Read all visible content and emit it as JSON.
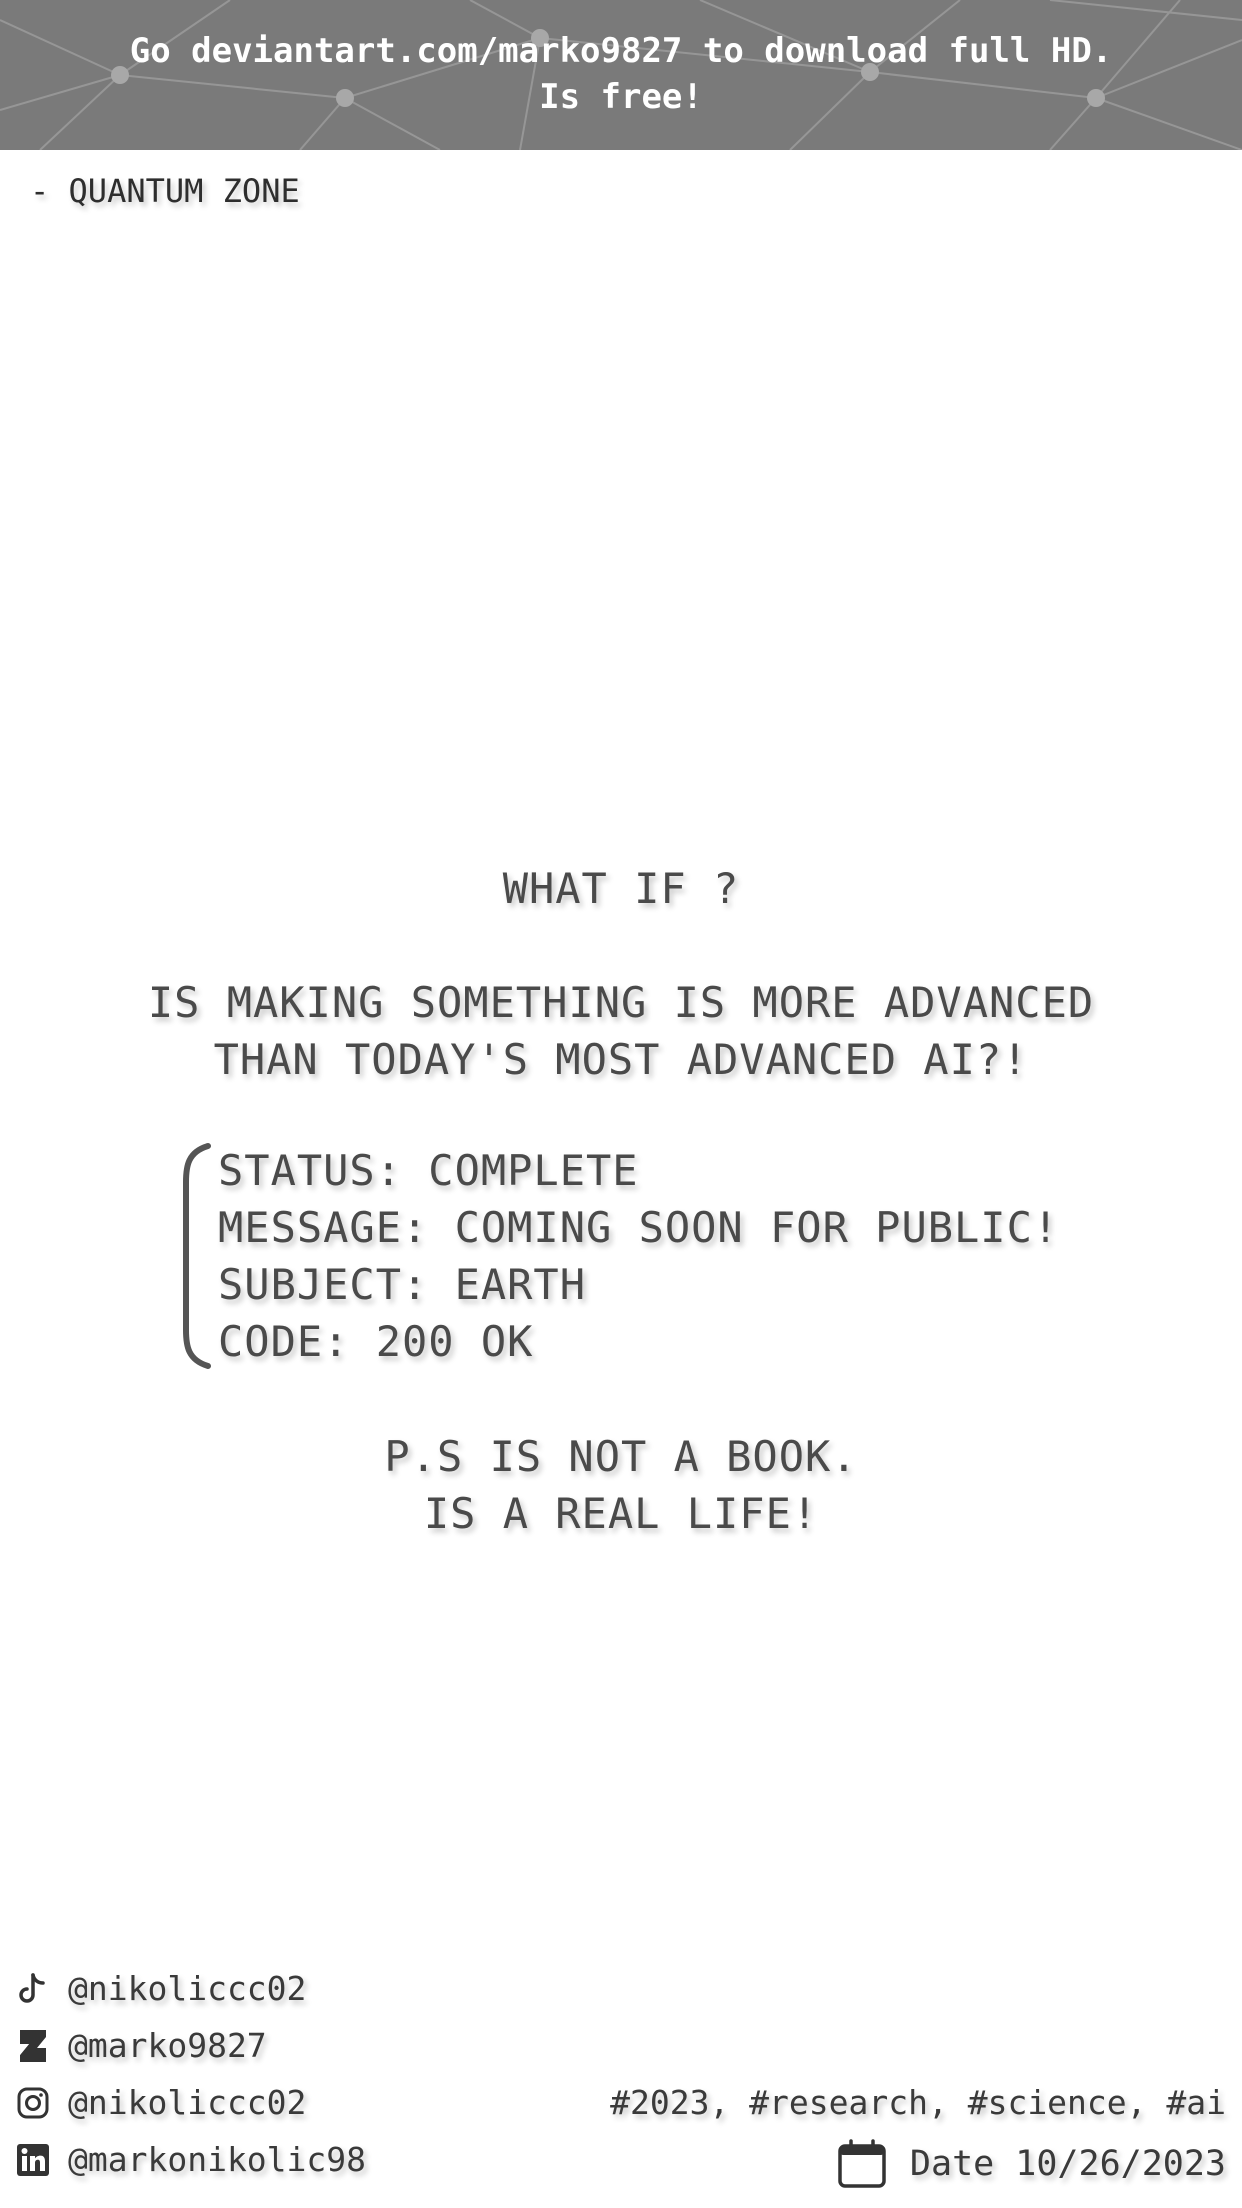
{
  "banner": {
    "line1": "Go deviantart.com/marko9827 to download full HD.",
    "line2": "Is free!"
  },
  "brand": "- QUANTUM ZONE",
  "headline": {
    "question": "WHAT IF ?",
    "line1": "IS MAKING SOMETHING IS MORE ADVANCED",
    "line2": "THAN TODAY'S MOST ADVANCED AI?!"
  },
  "status": {
    "lines": [
      "STATUS: COMPLETE",
      "MESSAGE: COMING SOON FOR PUBLIC!",
      "SUBJECT: EARTH",
      "CODE: 200 OK"
    ]
  },
  "ps": {
    "line1": "P.S IS NOT A BOOK.",
    "line2": "IS A REAL LIFE!"
  },
  "socials": [
    {
      "icon": "tiktok-icon",
      "handle": "@nikoliccc02"
    },
    {
      "icon": "deviantart-icon",
      "handle": "@marko9827"
    },
    {
      "icon": "instagram-icon",
      "handle": "@nikoliccc02"
    },
    {
      "icon": "linkedin-icon",
      "handle": "@markonikolic98"
    }
  ],
  "tags": "#2023, #research, #science, #ai",
  "date": {
    "icon": "calendar-icon",
    "text": "Date 10/26/2023"
  },
  "colors": {
    "banner_bg": "#7a7a7a",
    "text": "#4a4a4a",
    "background": "#ffffff"
  }
}
